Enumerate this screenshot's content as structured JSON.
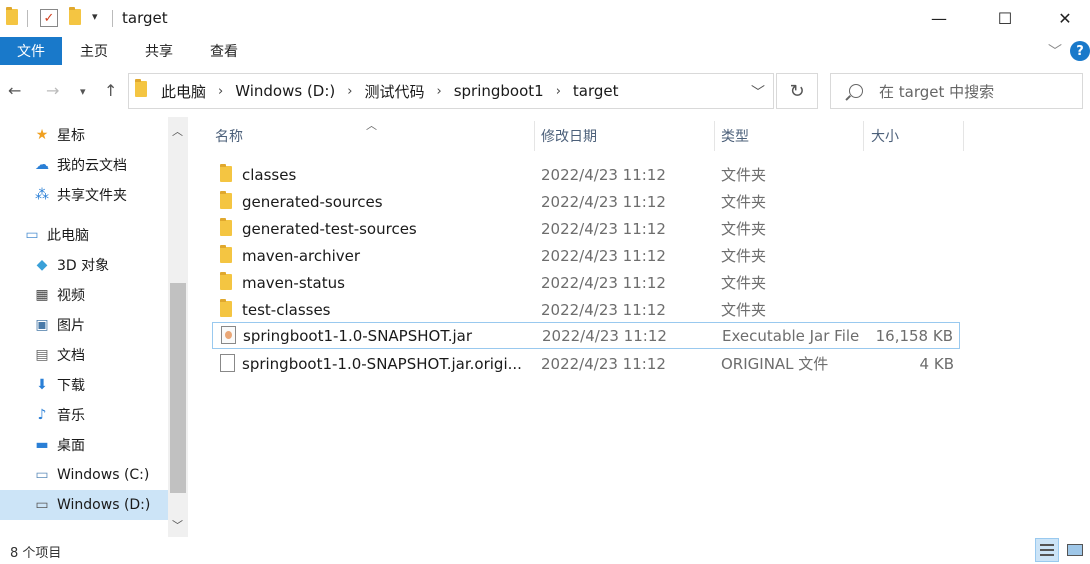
{
  "window": {
    "title": "target",
    "minimize": "—",
    "maximize": "☐",
    "close": "✕"
  },
  "ribbon": {
    "file": "文件",
    "tabs": [
      "主页",
      "共享",
      "查看"
    ],
    "help": "?"
  },
  "address": {
    "crumbs": [
      "此电脑",
      "Windows (D:)",
      "测试代码",
      "springboot1",
      "target"
    ],
    "search_placeholder": "在 target 中搜索"
  },
  "sidebar": {
    "items": [
      {
        "label": "星标",
        "icon": "star-icon"
      },
      {
        "label": "我的云文档",
        "icon": "cloud-icon"
      },
      {
        "label": "共享文件夹",
        "icon": "share-icon"
      },
      {
        "label": "此电脑",
        "icon": "computer-icon"
      },
      {
        "label": "3D 对象",
        "icon": "cube-icon"
      },
      {
        "label": "视频",
        "icon": "video-icon"
      },
      {
        "label": "图片",
        "icon": "picture-icon"
      },
      {
        "label": "文档",
        "icon": "document-icon"
      },
      {
        "label": "下载",
        "icon": "download-icon"
      },
      {
        "label": "音乐",
        "icon": "music-icon"
      },
      {
        "label": "桌面",
        "icon": "desktop-icon"
      },
      {
        "label": "Windows (C:)",
        "icon": "drive-icon"
      },
      {
        "label": "Windows (D:)",
        "icon": "drive-icon"
      }
    ]
  },
  "columns": {
    "name": "名称",
    "date": "修改日期",
    "type": "类型",
    "size": "大小"
  },
  "files": [
    {
      "name": "classes",
      "date": "2022/4/23 11:12",
      "type": "文件夹",
      "size": "",
      "icon": "folder-icon"
    },
    {
      "name": "generated-sources",
      "date": "2022/4/23 11:12",
      "type": "文件夹",
      "size": "",
      "icon": "folder-icon"
    },
    {
      "name": "generated-test-sources",
      "date": "2022/4/23 11:12",
      "type": "文件夹",
      "size": "",
      "icon": "folder-icon"
    },
    {
      "name": "maven-archiver",
      "date": "2022/4/23 11:12",
      "type": "文件夹",
      "size": "",
      "icon": "folder-icon"
    },
    {
      "name": "maven-status",
      "date": "2022/4/23 11:12",
      "type": "文件夹",
      "size": "",
      "icon": "folder-icon"
    },
    {
      "name": "test-classes",
      "date": "2022/4/23 11:12",
      "type": "文件夹",
      "size": "",
      "icon": "folder-icon"
    },
    {
      "name": "springboot1-1.0-SNAPSHOT.jar",
      "date": "2022/4/23 11:12",
      "type": "Executable Jar File",
      "size": "16,158 KB",
      "icon": "jar-icon"
    },
    {
      "name": "springboot1-1.0-SNAPSHOT.jar.origi...",
      "date": "2022/4/23 11:12",
      "type": "ORIGINAL 文件",
      "size": "4 KB",
      "icon": "file-icon"
    }
  ],
  "status": {
    "count": "8 个项目"
  },
  "colors": {
    "accent": "#1979ca",
    "selected": "#cce4f7"
  }
}
